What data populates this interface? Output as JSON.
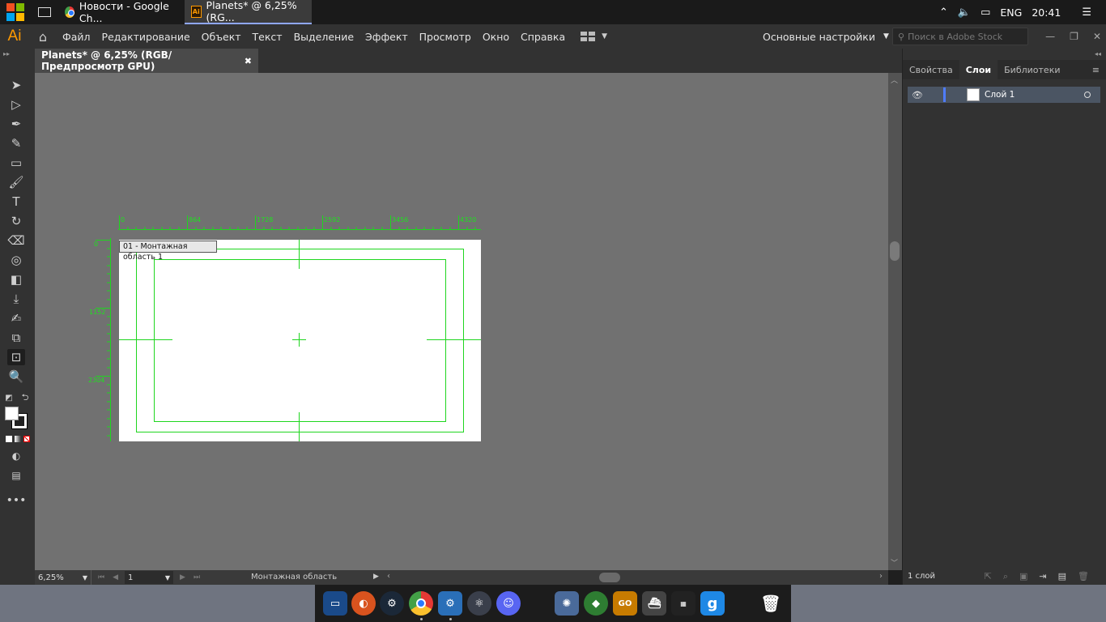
{
  "taskbar": {
    "tabs": [
      {
        "label": "Новости - Google Ch...",
        "icon": "chrome-icon"
      },
      {
        "label": "Planets* @ 6,25% (RG...",
        "icon": "illustrator-icon"
      }
    ],
    "language": "ENG",
    "time": "20:41"
  },
  "app": {
    "logo": "Ai",
    "menu": [
      "Файл",
      "Редактирование",
      "Объект",
      "Текст",
      "Выделение",
      "Эффект",
      "Просмотр",
      "Окно",
      "Справка"
    ],
    "workspace": "Основные настройки",
    "stock_search_placeholder": "Поиск в Adobe Stock"
  },
  "document": {
    "tab_title": "Planets* @ 6,25% (RGB/Предпросмотр GPU)",
    "artboard_label": "01 - Монтажная область 1"
  },
  "rulers": {
    "horizontal": [
      "0",
      "864",
      "1728",
      "2592",
      "3456",
      "4320"
    ],
    "vertical": [
      "0",
      "1152",
      "2304"
    ]
  },
  "status": {
    "zoom": "6,25%",
    "page": "1",
    "mode": "Монтажная область"
  },
  "panel": {
    "tabs": [
      "Свойства",
      "Слои",
      "Библиотеки"
    ],
    "active_tab": "Слои",
    "layers": [
      {
        "name": "Слой 1",
        "visible": true
      }
    ],
    "footer": "1 слой"
  },
  "colors": {
    "accent": "#ff9a00",
    "guide": "#1fd61f",
    "canvas": "#717171",
    "layer_color": "#4f7cff"
  }
}
